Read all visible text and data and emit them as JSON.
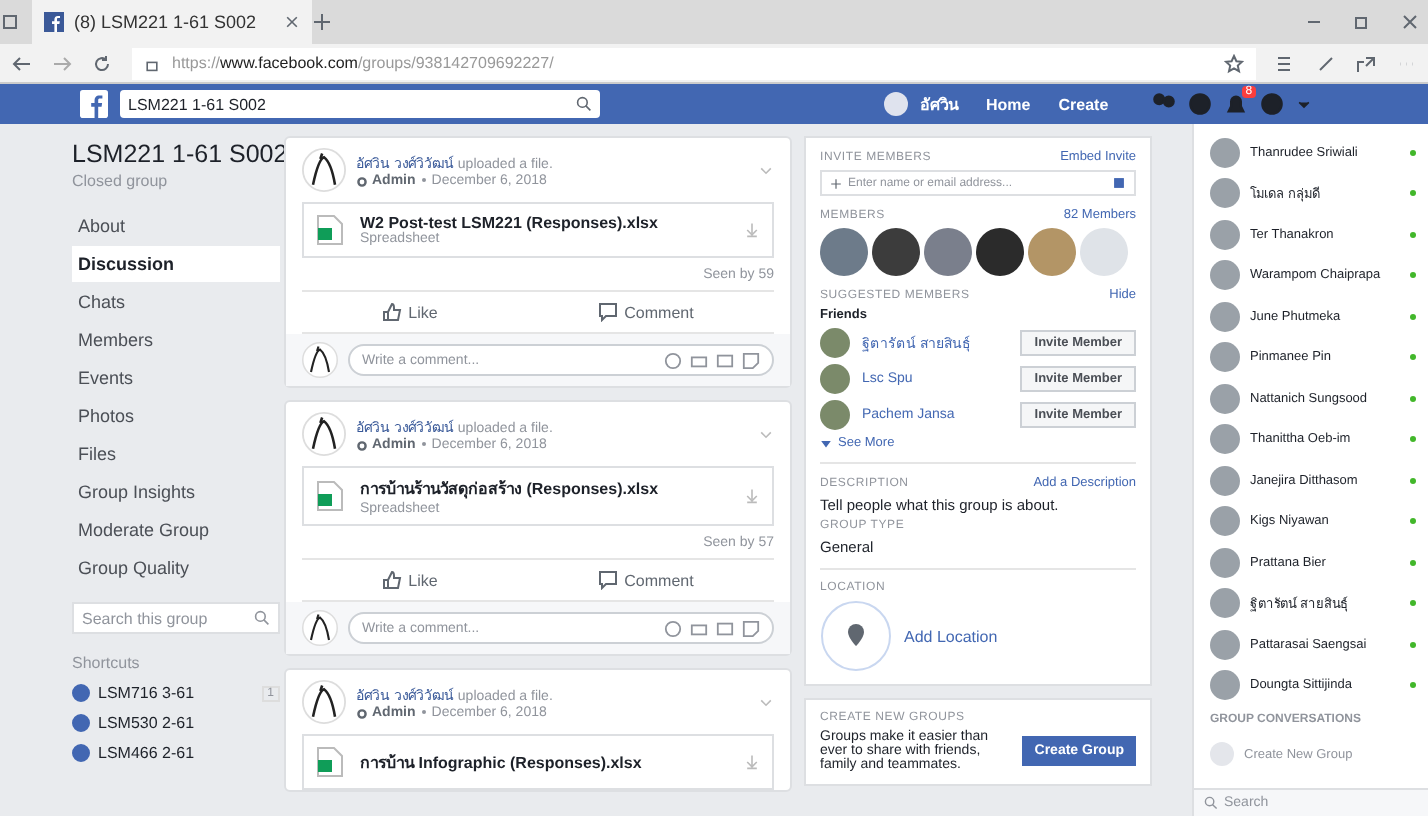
{
  "browser": {
    "tab_title": "(8) LSM221 1-61 S002",
    "url_scheme": "https://",
    "url_host": "www.facebook.com",
    "url_path": "/groups/938142709692227/"
  },
  "header": {
    "search": "LSM221 1-61 S002",
    "profile_name": "อัศวิน",
    "nav": [
      "Home",
      "Create"
    ],
    "notification_count": "8"
  },
  "group": {
    "title": "LSM221 1-61 S002",
    "privacy": "Closed group"
  },
  "nav_items": [
    {
      "label": "About",
      "selected": false
    },
    {
      "label": "Discussion",
      "selected": true
    },
    {
      "label": "Chats",
      "selected": false
    },
    {
      "label": "Members",
      "selected": false
    },
    {
      "label": "Events",
      "selected": false
    },
    {
      "label": "Photos",
      "selected": false
    },
    {
      "label": "Files",
      "selected": false
    },
    {
      "label": "Group Insights",
      "selected": false
    },
    {
      "label": "Moderate Group",
      "selected": false
    },
    {
      "label": "Group Quality",
      "selected": false
    }
  ],
  "group_search": {
    "placeholder": "Search this group"
  },
  "shortcuts": {
    "title": "Shortcuts",
    "items": [
      {
        "label": "LSM716 3-61",
        "count": "1"
      },
      {
        "label": "LSM530 2-61"
      },
      {
        "label": "LSM466 2-61"
      }
    ]
  },
  "posts": [
    {
      "author": "อัศวิน วงศ์วิวัฒน์",
      "action": "uploaded a file.",
      "role": "Admin",
      "date": "December 6, 2018",
      "file_name": "W2 Post-test LSM221 (Responses).xlsx",
      "file_type": "Spreadsheet",
      "seen": "Seen by 59",
      "like": "Like",
      "comment": "Comment",
      "comment_placeholder": "Write a comment..."
    },
    {
      "author": "อัศวิน วงศ์วิวัฒน์",
      "action": "uploaded a file.",
      "role": "Admin",
      "date": "December 6, 2018",
      "file_name": "การบ้านร้านวัสดุก่อสร้าง (Responses).xlsx",
      "file_type": "Spreadsheet",
      "seen": "Seen by 57",
      "like": "Like",
      "comment": "Comment",
      "comment_placeholder": "Write a comment..."
    },
    {
      "author": "อัศวิน วงศ์วิวัฒน์",
      "action": "uploaded a file.",
      "role": "Admin",
      "date": "December 6, 2018",
      "file_name": "การบ้าน Infographic (Responses).xlsx"
    }
  ],
  "invite": {
    "title": "INVITE MEMBERS",
    "embed": "Embed Invite",
    "placeholder": "Enter name or email address...",
    "members_title": "MEMBERS",
    "members_count": "82 Members",
    "suggested_title": "SUGGESTED MEMBERS",
    "hide": "Hide",
    "friends": "Friends",
    "suggested": [
      {
        "name": "ฐิตารัตน์ สายสินธุ์",
        "button": "Invite Member"
      },
      {
        "name": "Lsc Spu",
        "button": "Invite Member"
      },
      {
        "name": "Pachem Jansa",
        "button": "Invite Member"
      }
    ],
    "see_more": "See More"
  },
  "about": {
    "description_title": "DESCRIPTION",
    "add_description": "Add a Description",
    "description": "Tell people what this group is about.",
    "type_title": "GROUP TYPE",
    "type": "General",
    "location_title": "LOCATION",
    "add_location": "Add Location"
  },
  "create_groups": {
    "title": "CREATE NEW GROUPS",
    "text": "Groups make it easier than ever to share with friends, family and teammates.",
    "button": "Create Group"
  },
  "contacts": [
    {
      "name": "Thanrudee Sriwiali",
      "online": true
    },
    {
      "name": "โมเดล กลุ่มดี",
      "online": true
    },
    {
      "name": "Ter Thanakron",
      "online": true
    },
    {
      "name": "Warampom Chaiprapa",
      "online": true
    },
    {
      "name": "June Phutmeka",
      "online": true
    },
    {
      "name": "Pinmanee Pin",
      "online": true
    },
    {
      "name": "Nattanich Sungsood",
      "online": true
    },
    {
      "name": "Thanittha Oeb-im",
      "online": true
    },
    {
      "name": "Janejira Ditthasom",
      "online": true
    },
    {
      "name": "Kigs Niyawan",
      "online": true
    },
    {
      "name": "Prattana Bier",
      "online": true
    },
    {
      "name": "ฐิตารัตน์ สายสินธุ์",
      "online": true
    },
    {
      "name": "Pattarasai Saengsai",
      "online": true
    },
    {
      "name": "Doungta Sittijinda",
      "online": true
    }
  ],
  "group_conversations": {
    "title": "GROUP CONVERSATIONS",
    "create": "Create New Group"
  },
  "chat_search": {
    "placeholder": "Search"
  }
}
